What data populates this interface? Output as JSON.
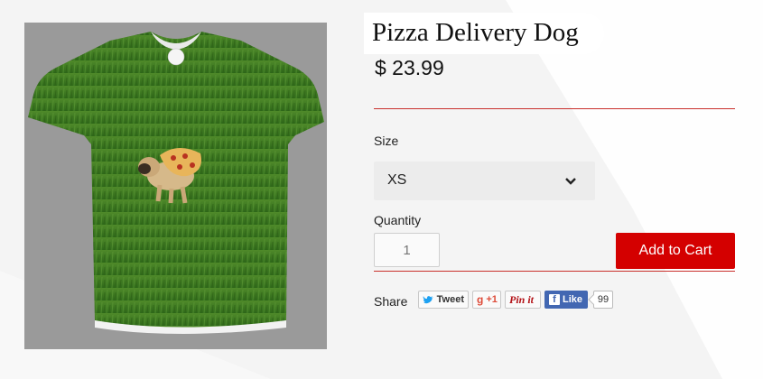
{
  "product": {
    "title": "Pizza Delivery Dog",
    "price": "$ 23.99",
    "image_alt": "T-shirt with pug wearing pizza on grass"
  },
  "size": {
    "label": "Size",
    "selected": "XS"
  },
  "quantity": {
    "label": "Quantity",
    "placeholder": "1"
  },
  "cart": {
    "button_label": "Add to Cart"
  },
  "share": {
    "label": "Share",
    "tweet_label": "Tweet",
    "gplus_label": "+1",
    "pin_label": "Pin it",
    "like_label": "Like",
    "like_count": "99"
  },
  "colors": {
    "accent": "#d40000",
    "divider": "#c9302c",
    "facebook": "#4267b2",
    "background": "#f4f4f4"
  }
}
